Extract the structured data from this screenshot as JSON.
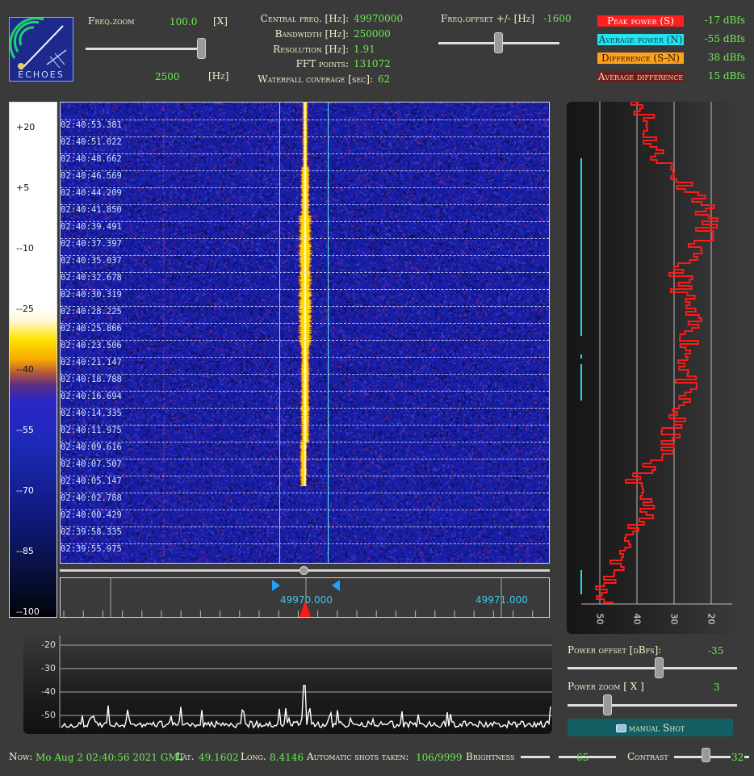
{
  "header": {
    "logo_text": "ECHOES",
    "freq_zoom_label": "Freq.zoom",
    "freq_zoom_value": "100.0",
    "freq_zoom_unit": "[X]",
    "span_value": "2500",
    "span_unit": "[Hz]",
    "central_freq_label": "Central freq. [Hz]:",
    "central_freq_value": "49970000",
    "bandwidth_label": "Bandwidth [Hz]:",
    "bandwidth_value": "250000",
    "resolution_label": "Resolution [Hz]:",
    "resolution_value": "1.91",
    "fft_label": "FFT points:",
    "fft_value": "131072",
    "waterfall_label": "Waterfall coverage [sec]:",
    "waterfall_value": "62",
    "freq_offset_label": "Freq.offset +/- [Hz]",
    "freq_offset_value": "-1600"
  },
  "legend": [
    {
      "label": "Peak power (S)",
      "value": "-17 dBfs",
      "color": "#ff1f1f",
      "text_color": "#ffffff"
    },
    {
      "label": "Average power (N)",
      "value": "-55 dBfs",
      "color": "#22e4ef",
      "text_color": "#0b3a5a"
    },
    {
      "label": "Difference (S-N)",
      "value": "38 dBfs",
      "color": "#ffa21a",
      "text_color": "#2a1600"
    },
    {
      "label": "Average difference",
      "value": "15 dBfs",
      "color": "#6b1e1e",
      "text_color": "#ffd28a"
    }
  ],
  "scale_labels": [
    "+20",
    "+5",
    "--10",
    "--25",
    "--40",
    "--55",
    "--70",
    "--85",
    "--100"
  ],
  "timestamps": [
    "02:40:53.381",
    "02:40:51.022",
    "02:40:48.662",
    "02:40:46.569",
    "02:40:44.209",
    "02:40:41.850",
    "02:40:39.491",
    "02:40:37.397",
    "02:40:35.037",
    "02:40:32.678",
    "02:40:30.319",
    "02:40:28.225",
    "02:40:25.866",
    "02:40:23.506",
    "02:40:21.147",
    "02:40:18.788",
    "02:40:16.694",
    "02:40:14.335",
    "02:40:11.975",
    "02:40:09.616",
    "02:40:07.507",
    "02:40:05.147",
    "02:40:02.788",
    "02:40:00.429",
    "02:39:58.335",
    "02:39:55.975"
  ],
  "freq_axis": {
    "left_label": "49970.000",
    "right_label": "49971.000"
  },
  "side_axis": [
    "50",
    "40",
    "30",
    "20"
  ],
  "spectrum_axis": [
    "-20",
    "-30",
    "-40",
    "-50"
  ],
  "controls": {
    "power_offset_label": "Power offset [dBfs]:",
    "power_offset_value": "-35",
    "power_zoom_label": "Power zoom [ X ]",
    "power_zoom_value": "3",
    "manual_shot_label": "manual Shot"
  },
  "status": {
    "now_label": "Now:",
    "now_value": "Mo Aug 2 02:40:56 2021 GMT",
    "lat_label": "Lat.",
    "lat_value": "49.1602",
    "long_label": "Long.",
    "long_value": "8.4146",
    "shots_label": "Automatic shots taken:",
    "shots_value": "106/9999",
    "brightness_label": "Brightness",
    "brightness_value": "65",
    "contrast_label": "Contrast",
    "contrast_value": "32"
  }
}
